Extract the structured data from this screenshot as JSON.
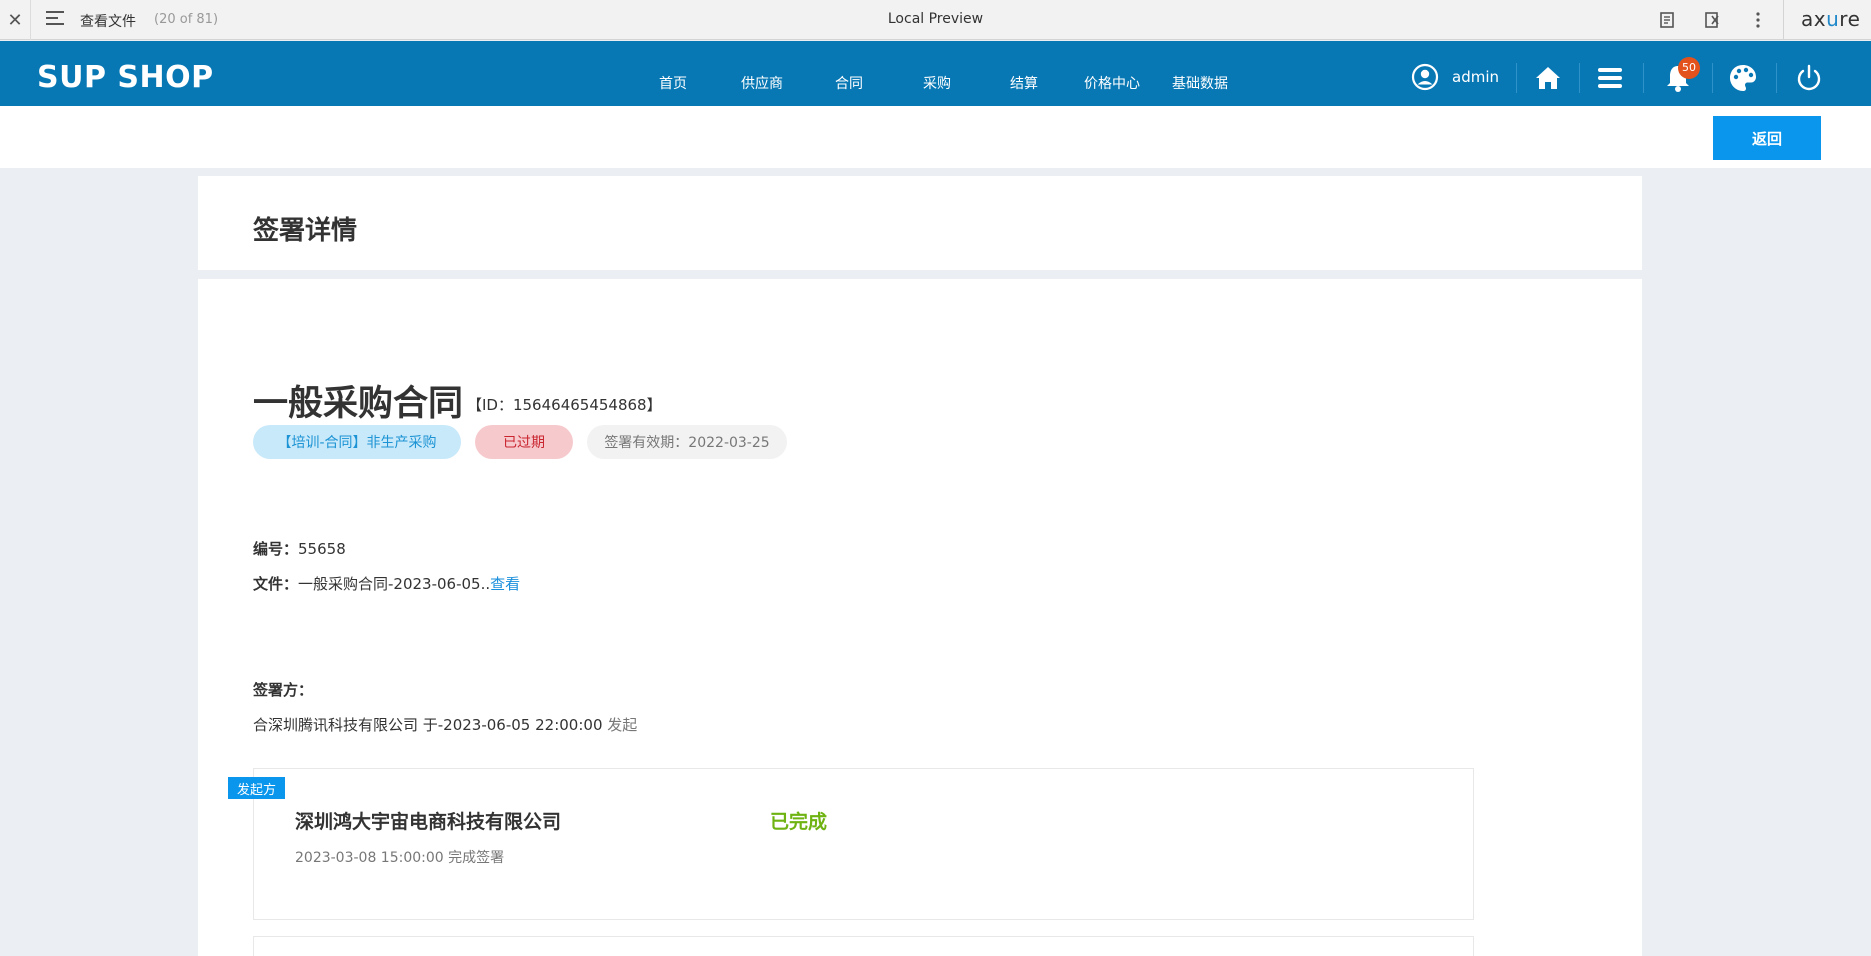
{
  "axure": {
    "page_name": "查看文件",
    "page_count": "(20 of 81)",
    "window_title": "Local Preview",
    "logo_a": "ax",
    "logo_b": "u",
    "logo_c": "re"
  },
  "app": {
    "brand": "SUP SHOP",
    "nav": [
      "首页",
      "供应商",
      "合同",
      "采购",
      "结算",
      "价格中心",
      "基础数据"
    ],
    "username": "admin",
    "notification_count": "50",
    "colors": {
      "header": "#0878b5",
      "primary": "#0a96ec",
      "success": "#6fb312",
      "danger": "#c9252f"
    }
  },
  "toolbar": {
    "back_label": "返回"
  },
  "page": {
    "title": "签署详情"
  },
  "contract": {
    "title": "一般采购合同",
    "id_text": "【ID：15646465454868】",
    "tags": {
      "type": "【培训-合同】非生产采购",
      "status": "已过期",
      "validity": "签署有效期：2022-03-25"
    },
    "number_label": "编号：",
    "number_value": "55658",
    "file_label": "文件：",
    "file_value": "一般采购合同-2023-06-05..",
    "file_link": "查看"
  },
  "signers": {
    "label": "签署方：",
    "summary_main": "合深圳腾讯科技有限公司 于-2023-06-05  22:00:00 ",
    "summary_action": "发起",
    "parties": [
      {
        "role": "发起方",
        "name": "深圳鸿大宇宙电商科技有限公司",
        "status": "已完成",
        "time": "2023-03-08 15:00:00 完成签署"
      }
    ]
  }
}
